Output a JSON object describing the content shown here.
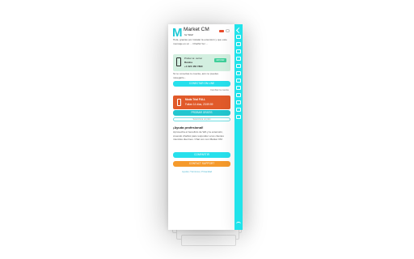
{
  "header": {
    "logo": "M",
    "app_name": "Market CM",
    "app_sub": "for WAZ"
  },
  "intro": {
    "text": "Hola, gracias por instalar la extensión y que este mensaje es un ... Chatfol Ver ..."
  },
  "connection": {
    "line1": "Prober te: cerrar",
    "line2": "Ruidos",
    "line3": "+1 023 456 7890",
    "button": "ENVIAR"
  },
  "note": {
    "text": "Si no conectas tu cuenta, aún no puedes navegarlo..."
  },
  "buttons": {
    "connect": "CONECTAR ON LINE",
    "connect_sub": "Cambiar la cuenta",
    "upgrade": "PROBAR GRATIS",
    "share": "COMPARTIR",
    "support": "CONTACT SUPPORT"
  },
  "trial": {
    "line1": "Modo Trial FULL",
    "line2": "Faltan 14 días, 23:59:59"
  },
  "select": {
    "placeholder": "Selecciona un plan"
  },
  "promo": {
    "title": "¡Ayuda profesional!",
    "text": "Aprovecha el beneficio de WA y la extensión, creando chatbot para responder a tus clientes mientras duermes. Chat con con Market CM."
  },
  "footer": {
    "link": "Ayuda | Términos | Privacidad"
  },
  "colors": {
    "accent": "#21e3ea",
    "orange": "#f59a2c",
    "red": "#e15a2a",
    "green": "#3fcf9a"
  }
}
